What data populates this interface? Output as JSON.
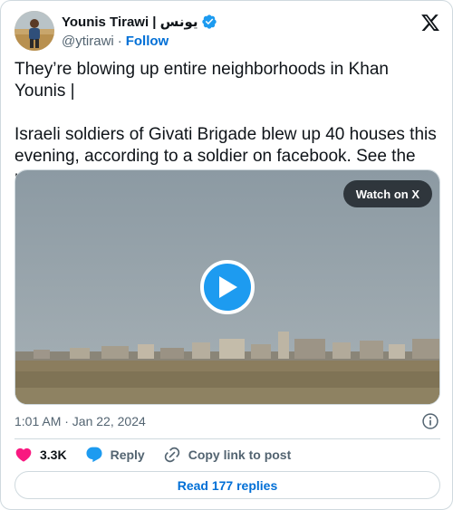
{
  "author": {
    "display_name": "Younis Tirawi | يونس",
    "handle": "@ytirawi",
    "follow_label": "Follow",
    "verified": true
  },
  "tweet": {
    "paragraphs": [
      "They’re blowing up entire neighborhoods in Khan Younis |",
      "Israeli soldiers of Givati Brigade blew up 40 houses this evening, according to a soldier on facebook. See the mines used in the comment."
    ]
  },
  "media": {
    "type": "video",
    "watch_label": "Watch on X"
  },
  "timestamp": "1:01 AM · Jan 22, 2024",
  "actions": {
    "likes_count": "3.3K",
    "reply_label": "Reply",
    "copy_link_label": "Copy link to post"
  },
  "read_replies_label": "Read 177 replies",
  "colors": {
    "accent": "#1d9bf0",
    "link": "#006fd6",
    "like": "#f91880",
    "text_secondary": "#536471",
    "border": "#cfd9de"
  },
  "icons": [
    "verified-badge-icon",
    "x-logo-icon",
    "play-icon",
    "info-icon",
    "heart-icon",
    "reply-bubble-icon",
    "link-icon"
  ]
}
